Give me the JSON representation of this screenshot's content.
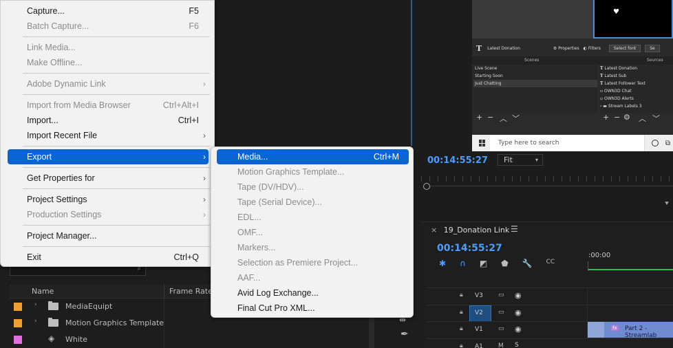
{
  "file_menu": {
    "items": [
      {
        "label": "Capture...",
        "shortcut": "F5"
      },
      {
        "label": "Batch Capture...",
        "shortcut": "F6"
      },
      {
        "label": "Link Media..."
      },
      {
        "label": "Make Offline..."
      },
      {
        "label": "Adobe Dynamic Link"
      },
      {
        "label": "Import from Media Browser",
        "shortcut": "Ctrl+Alt+I"
      },
      {
        "label": "Import...",
        "shortcut": "Ctrl+I"
      },
      {
        "label": "Import Recent File"
      },
      {
        "label": "Export"
      },
      {
        "label": "Get Properties for"
      },
      {
        "label": "Project Settings"
      },
      {
        "label": "Production Settings"
      },
      {
        "label": "Project Manager..."
      },
      {
        "label": "Exit",
        "shortcut": "Ctrl+Q"
      }
    ]
  },
  "export_submenu": {
    "items": [
      {
        "label": "Media...",
        "shortcut": "Ctrl+M"
      },
      {
        "label": "Motion Graphics Template..."
      },
      {
        "label": "Tape (DV/HDV)..."
      },
      {
        "label": "Tape (Serial Device)..."
      },
      {
        "label": "EDL..."
      },
      {
        "label": "OMF..."
      },
      {
        "label": "Markers..."
      },
      {
        "label": "Selection as Premiere Project..."
      },
      {
        "label": "AAF..."
      },
      {
        "label": "Avid Log Exchange..."
      },
      {
        "label": "Final Cut Pro XML..."
      }
    ]
  },
  "obs": {
    "source_selected": "Latest Donation",
    "toolbar": {
      "properties": "Properties",
      "filters": "Filters",
      "select_font": "Select font",
      "se": "Se"
    },
    "scenes_header": "Scenes",
    "sources_header": "Sources",
    "scenes": [
      "Live Scene",
      "Starting Soon",
      "Just Chatting"
    ],
    "sources": [
      "Latest Donation",
      "Latest Sub",
      "Latest Follower Text",
      "OWN3D Chat",
      "OWN3D Alerts",
      "Stream Labels 3"
    ],
    "taskbar_search": "Type here to search"
  },
  "program_monitor": {
    "timecode": "00:14:55:27",
    "fit": "Fit"
  },
  "timeline": {
    "sequence_name": "19_Donation Link",
    "timecode": "00:14:55:27",
    "ruler_time": ":00:00",
    "tracks": [
      "V3",
      "V2",
      "V1",
      "A1"
    ],
    "clip_label": "Part 2 - Streamlab"
  },
  "project_panel": {
    "col_name": "Name",
    "col_frame_rate": "Frame Rate",
    "rows": [
      {
        "label": "MediaEquipt",
        "color": "#f0a030"
      },
      {
        "label": "Motion Graphics Template",
        "color": "#f0a030"
      },
      {
        "label": "White",
        "color": "#e070e0"
      }
    ]
  },
  "colors": {
    "accent": "#0a64d6",
    "timecode": "#4a9eff"
  }
}
